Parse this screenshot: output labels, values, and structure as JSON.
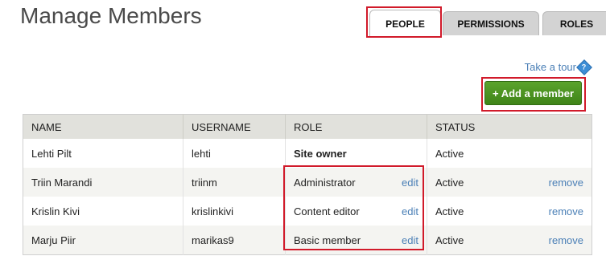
{
  "page": {
    "title": "Manage Members"
  },
  "tabs": [
    {
      "label": "PEOPLE",
      "active": true
    },
    {
      "label": "PERMISSIONS",
      "active": false
    },
    {
      "label": "ROLES",
      "active": false
    }
  ],
  "tour": {
    "label": "Take a tour",
    "icon": "help-diamond-icon",
    "icon_glyph": "?"
  },
  "add_button": {
    "label": "+ Add a member",
    "color": "#4e9a24"
  },
  "highlight_color": "#d11a2a",
  "table": {
    "columns": [
      "NAME",
      "USERNAME",
      "ROLE",
      "STATUS"
    ],
    "rows": [
      {
        "name": "Lehti Pilt",
        "username": "lehti",
        "role": "Site owner",
        "role_edit": "",
        "status": "Active",
        "remove": ""
      },
      {
        "name": "Triin Marandi",
        "username": "triinm",
        "role": "Administrator",
        "role_edit": "edit",
        "status": "Active",
        "remove": "remove"
      },
      {
        "name": "Krislin Kivi",
        "username": "krislinkivi",
        "role": "Content editor",
        "role_edit": "edit",
        "status": "Active",
        "remove": "remove"
      },
      {
        "name": "Marju Piir",
        "username": "marikas9",
        "role": "Basic member",
        "role_edit": "edit",
        "status": "Active",
        "remove": "remove"
      }
    ]
  }
}
